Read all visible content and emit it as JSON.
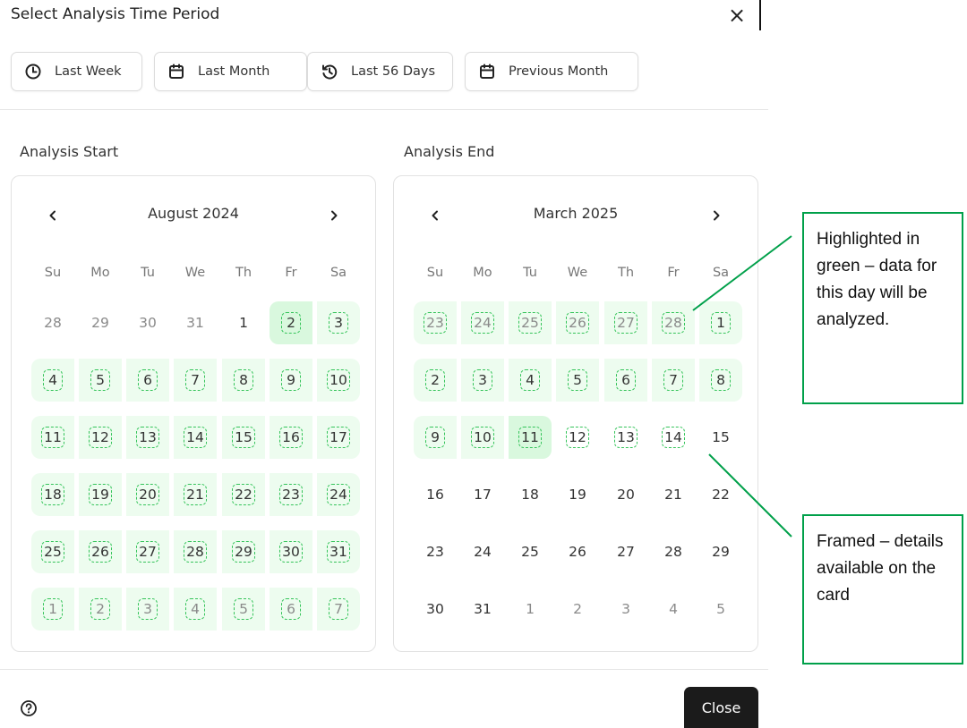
{
  "dialog": {
    "title": "Select Analysis Time Period",
    "close_glyph": "×"
  },
  "presets": [
    {
      "label": "Last Week",
      "icon": "clock-icon"
    },
    {
      "label": "Last Month",
      "icon": "calendar-icon"
    },
    {
      "label": "Last 56 Days",
      "icon": "history-icon"
    },
    {
      "label": "Previous Month",
      "icon": "calendar-icon"
    }
  ],
  "weekdays": [
    "Su",
    "Mo",
    "Tu",
    "We",
    "Th",
    "Fr",
    "Sa"
  ],
  "start": {
    "label": "Analysis Start",
    "month": "August 2024",
    "weeks": [
      [
        {
          "d": "28",
          "m": true
        },
        {
          "d": "29",
          "m": true
        },
        {
          "d": "30",
          "m": true
        },
        {
          "d": "31",
          "m": true
        },
        {
          "d": "1"
        },
        {
          "d": "2",
          "g": true,
          "s": true,
          "f": true
        },
        {
          "d": "3",
          "g": true,
          "f": true
        }
      ],
      [
        {
          "d": "4",
          "g": true,
          "f": true
        },
        {
          "d": "5",
          "g": true,
          "f": true
        },
        {
          "d": "6",
          "g": true,
          "f": true
        },
        {
          "d": "7",
          "g": true,
          "f": true
        },
        {
          "d": "8",
          "g": true,
          "f": true
        },
        {
          "d": "9",
          "g": true,
          "f": true
        },
        {
          "d": "10",
          "g": true,
          "f": true
        }
      ],
      [
        {
          "d": "11",
          "g": true,
          "f": true
        },
        {
          "d": "12",
          "g": true,
          "f": true
        },
        {
          "d": "13",
          "g": true,
          "f": true
        },
        {
          "d": "14",
          "g": true,
          "f": true
        },
        {
          "d": "15",
          "g": true,
          "f": true
        },
        {
          "d": "16",
          "g": true,
          "f": true
        },
        {
          "d": "17",
          "g": true,
          "f": true
        }
      ],
      [
        {
          "d": "18",
          "g": true,
          "f": true
        },
        {
          "d": "19",
          "g": true,
          "f": true
        },
        {
          "d": "20",
          "g": true,
          "f": true
        },
        {
          "d": "21",
          "g": true,
          "f": true
        },
        {
          "d": "22",
          "g": true,
          "f": true
        },
        {
          "d": "23",
          "g": true,
          "f": true
        },
        {
          "d": "24",
          "g": true,
          "f": true
        }
      ],
      [
        {
          "d": "25",
          "g": true,
          "f": true
        },
        {
          "d": "26",
          "g": true,
          "f": true
        },
        {
          "d": "27",
          "g": true,
          "f": true
        },
        {
          "d": "28",
          "g": true,
          "f": true
        },
        {
          "d": "29",
          "g": true,
          "f": true
        },
        {
          "d": "30",
          "g": true,
          "f": true
        },
        {
          "d": "31",
          "g": true,
          "f": true
        }
      ],
      [
        {
          "d": "1",
          "m": true,
          "g": true,
          "f": true
        },
        {
          "d": "2",
          "m": true,
          "g": true,
          "f": true
        },
        {
          "d": "3",
          "m": true,
          "g": true,
          "f": true
        },
        {
          "d": "4",
          "m": true,
          "g": true,
          "f": true
        },
        {
          "d": "5",
          "m": true,
          "g": true,
          "f": true
        },
        {
          "d": "6",
          "m": true,
          "g": true,
          "f": true
        },
        {
          "d": "7",
          "m": true,
          "g": true,
          "f": true
        }
      ]
    ]
  },
  "end": {
    "label": "Analysis End",
    "month": "March 2025",
    "weeks": [
      [
        {
          "d": "23",
          "m": true,
          "g": true,
          "f": true
        },
        {
          "d": "24",
          "m": true,
          "g": true,
          "f": true
        },
        {
          "d": "25",
          "m": true,
          "g": true,
          "f": true
        },
        {
          "d": "26",
          "m": true,
          "g": true,
          "f": true
        },
        {
          "d": "27",
          "m": true,
          "g": true,
          "f": true
        },
        {
          "d": "28",
          "m": true,
          "g": true,
          "f": true
        },
        {
          "d": "1",
          "g": true,
          "f": true
        }
      ],
      [
        {
          "d": "2",
          "g": true,
          "f": true
        },
        {
          "d": "3",
          "g": true,
          "f": true
        },
        {
          "d": "4",
          "g": true,
          "f": true
        },
        {
          "d": "5",
          "g": true,
          "f": true
        },
        {
          "d": "6",
          "g": true,
          "f": true
        },
        {
          "d": "7",
          "g": true,
          "f": true
        },
        {
          "d": "8",
          "g": true,
          "f": true
        }
      ],
      [
        {
          "d": "9",
          "g": true,
          "f": true
        },
        {
          "d": "10",
          "g": true,
          "f": true
        },
        {
          "d": "11",
          "g": true,
          "s": true,
          "f": true
        },
        {
          "d": "12",
          "f": true
        },
        {
          "d": "13",
          "f": true
        },
        {
          "d": "14",
          "f": true
        },
        {
          "d": "15"
        }
      ],
      [
        {
          "d": "16"
        },
        {
          "d": "17"
        },
        {
          "d": "18"
        },
        {
          "d": "19"
        },
        {
          "d": "20"
        },
        {
          "d": "21"
        },
        {
          "d": "22"
        }
      ],
      [
        {
          "d": "23"
        },
        {
          "d": "24"
        },
        {
          "d": "25"
        },
        {
          "d": "26"
        },
        {
          "d": "27"
        },
        {
          "d": "28"
        },
        {
          "d": "29"
        }
      ],
      [
        {
          "d": "30"
        },
        {
          "d": "31"
        },
        {
          "d": "1",
          "m": true
        },
        {
          "d": "2",
          "m": true
        },
        {
          "d": "3",
          "m": true
        },
        {
          "d": "4",
          "m": true
        },
        {
          "d": "5",
          "m": true
        }
      ]
    ]
  },
  "footer": {
    "help_icon": "help-circle-icon",
    "close_label": "Close"
  },
  "annotations": {
    "highlighted": "Highlighted in green – data for this day will be analyzed.",
    "framed": "Framed – details available on the card"
  },
  "colors": {
    "highlight_fill": "#edfcef",
    "selected_fill": "#d9f8de",
    "frame_border": "#35c45a",
    "annotation_green": "#00a04a",
    "close_button": "#1b1b1b"
  }
}
